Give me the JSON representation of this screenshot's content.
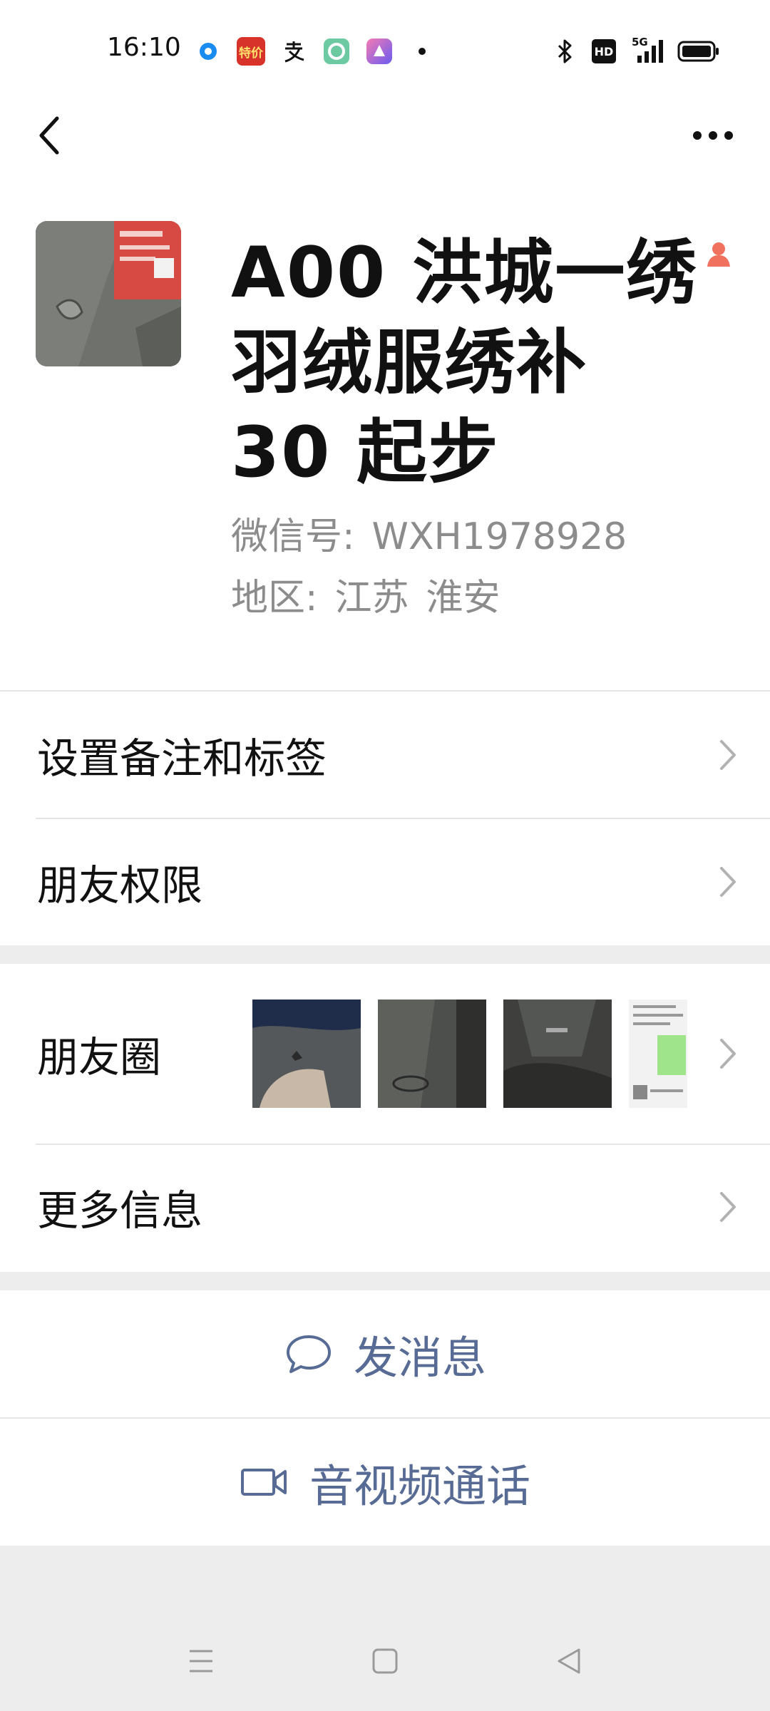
{
  "status_bar": {
    "time": "16:10",
    "left_icons": [
      "blue-dot-app-icon",
      "tejia-app-icon",
      "alipay-icon",
      "green-ring-app-icon",
      "purple-app-icon",
      "more-dot-icon"
    ],
    "tejia_label": "特价",
    "right_icons": [
      "bluetooth-icon",
      "hd-icon",
      "5g-signal-icon",
      "battery-icon"
    ],
    "hd_label": "HD",
    "network_label": "5G"
  },
  "header": {
    "back_icon": "chevron-left-icon",
    "more_icon": "more-dots-icon"
  },
  "profile": {
    "display_name": "A00 洪城一绣羽绒服绣补 30 起步",
    "gender_icon": "person-female-icon",
    "wxid_label": "微信号:",
    "wxid_value": "WXH1978928",
    "region_label": "地区:",
    "region_province": "江苏",
    "region_city": "淮安"
  },
  "menu": {
    "remark_tags": "设置备注和标签",
    "friend_permissions": "朋友权限",
    "moments": "朋友圈",
    "more_info": "更多信息"
  },
  "actions": {
    "send_message": "发消息",
    "video_call": "音视频通话"
  },
  "colors": {
    "link_blue": "#576b95",
    "gender_orange": "#f0715e",
    "secondary_text": "#8c8c8c",
    "background": "#ededed"
  },
  "sysnav": {
    "menu_icon": "menu-lines-icon",
    "home_icon": "square-home-icon",
    "back_icon": "triangle-back-icon"
  }
}
